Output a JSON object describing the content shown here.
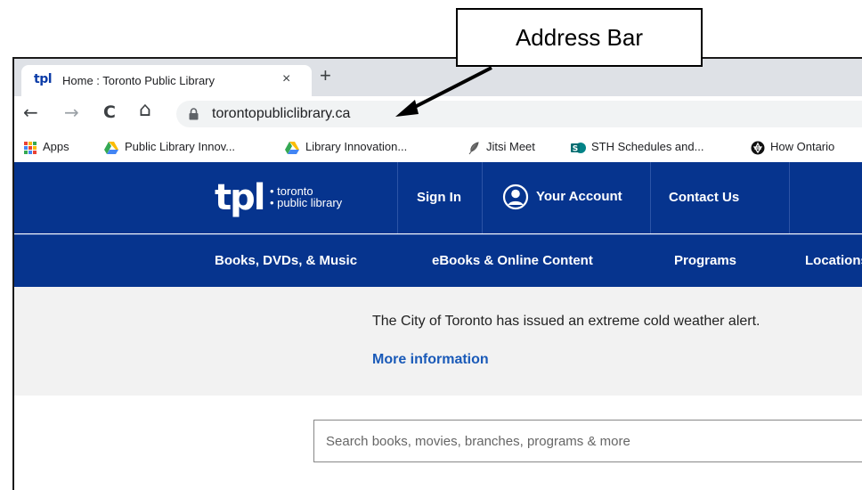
{
  "annotation": {
    "label": "Address Bar"
  },
  "browser": {
    "tab": {
      "favicon": "tpl",
      "title": "Home : Toronto Public Library",
      "close": "×"
    },
    "new_tab": "+",
    "nav": {
      "back": "←",
      "forward": "→",
      "reload": "C",
      "home": "⌂"
    },
    "url": "torontopubliclibrary.ca"
  },
  "bookmarks": [
    {
      "label": "Apps",
      "icon": "apps-grid-icon"
    },
    {
      "label": "Public Library Innov...",
      "icon": "google-drive-icon"
    },
    {
      "label": "Library Innovation...",
      "icon": "google-drive-icon"
    },
    {
      "label": "Jitsi Meet",
      "icon": "jitsi-feather-icon"
    },
    {
      "label": "STH Schedules and...",
      "icon": "sharepoint-icon"
    },
    {
      "label": "How Ontario",
      "icon": "ontario-trillium-icon"
    }
  ],
  "site": {
    "logo": {
      "mark": "tpl",
      "line1": "toronto",
      "line2": "public library"
    },
    "header_links": {
      "sign_in": "Sign In",
      "your_account": "Your Account",
      "contact_us": "Contact Us"
    },
    "nav": [
      "Books, DVDs, & Music",
      "eBooks & Online Content",
      "Programs",
      "Locations"
    ],
    "alert": {
      "text": "The City of Toronto has issued an extreme cold weather alert.",
      "link": "More information"
    },
    "search": {
      "placeholder": "Search books, movies, branches, programs & more"
    }
  },
  "colors": {
    "brand_blue": "#06348e",
    "link_blue": "#1a5ab8",
    "alert_bg": "#f2f2f2"
  }
}
